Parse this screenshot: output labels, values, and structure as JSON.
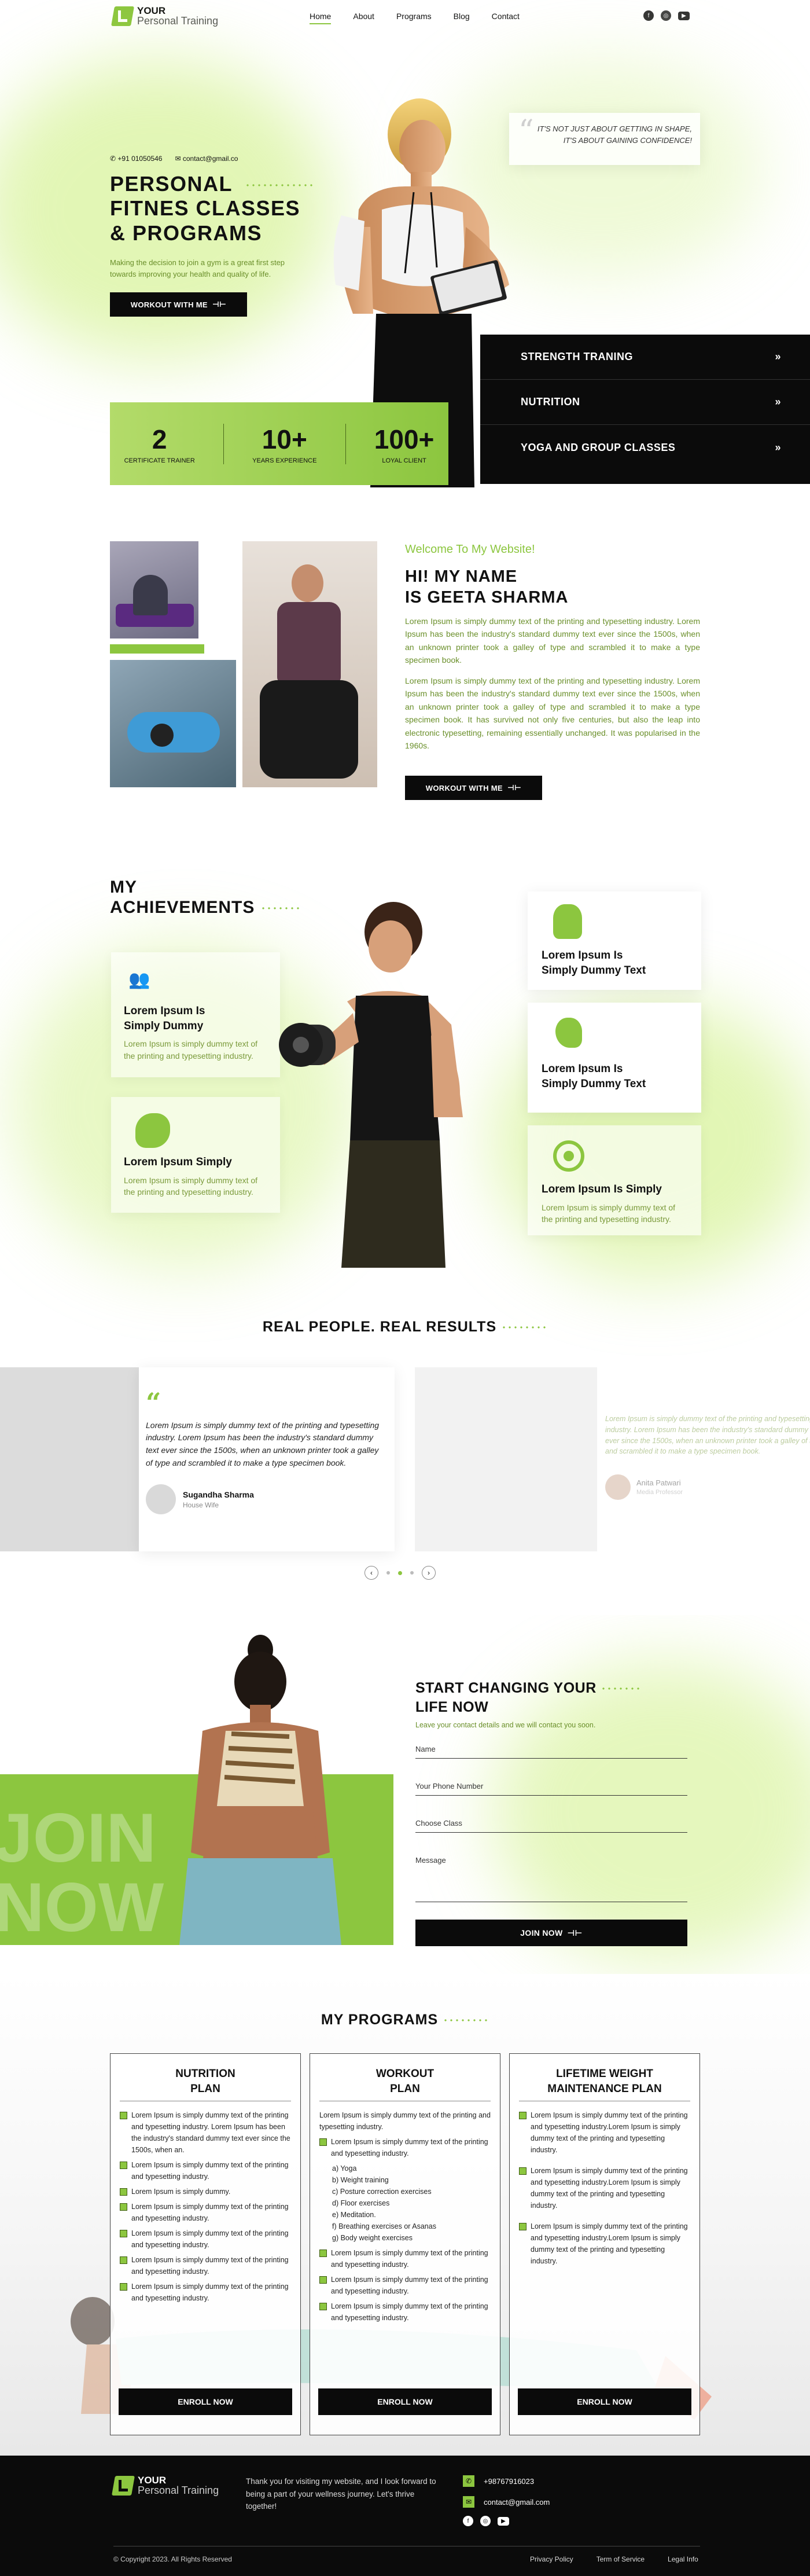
{
  "brand": {
    "line1": "YOUR",
    "line2": "Personal Training",
    "accent": "#8cc63f"
  },
  "nav": {
    "items": [
      "Home",
      "About",
      "Programs",
      "Blog",
      "Contact"
    ],
    "active": "Home"
  },
  "social": [
    "facebook-icon",
    "instagram-icon",
    "youtube-icon"
  ],
  "hero": {
    "phone": "+91 01050546",
    "email": "contact@gmail.co",
    "title_l1": "PERSONAL",
    "title_l2": "FITNES CLASSES",
    "title_l3": "& PROGRAMS",
    "subtitle": "Making the decision to join a gym is a great first step towards improving your health and quality of life.",
    "cta": "WORKOUT WITH ME",
    "quote": "IT'S NOT JUST ABOUT GETTING IN SHAPE, IT'S ABOUT GAINING CONFIDENCE!",
    "stats": [
      {
        "value": "2",
        "label": "CERTIFICATE TRAINER"
      },
      {
        "value": "10+",
        "label": "YEARS EXPERIENCE"
      },
      {
        "value": "100+",
        "label": "LOYAL CLIENT"
      }
    ],
    "services": [
      "STRENGTH TRANING",
      "NUTRITION",
      "YOGA AND GROUP CLASSES"
    ]
  },
  "about": {
    "welcome": "Welcome To My Website!",
    "title_l1": "HI! MY NAME",
    "title_l2": "IS GEETA SHARMA",
    "p1": "Lorem Ipsum is simply dummy text of the printing and typesetting industry. Lorem Ipsum has been the industry's standard dummy text ever since the 1500s, when an unknown printer took a galley of type and scrambled it to make a type specimen book.",
    "p2": "Lorem Ipsum is simply dummy text of the printing and typesetting industry. Lorem Ipsum has been the industry's standard dummy text ever since the 1500s, when an unknown printer took a galley of type and scrambled it to make a type specimen book. It has survived not only five centuries, but also the leap into electronic typesetting, remaining essentially unchanged. It was popularised in the 1960s.",
    "cta": "WORKOUT WITH ME"
  },
  "achievements": {
    "title_l1": "MY",
    "title_l2": "ACHIEVEMENTS",
    "left": [
      {
        "title": "Lorem Ipsum Is Simply Dummy",
        "text": "Lorem Ipsum is simply dummy text of the printing and typesetting industry.",
        "icon": "group-icon"
      },
      {
        "title": "Lorem Ipsum Simply",
        "text": "Lorem Ipsum is simply dummy text of the printing and typesetting industry.",
        "icon": "runner-icon"
      }
    ],
    "right": [
      {
        "title": "Lorem Ipsum Is Simply Dummy Text",
        "icon": "fitness-icon"
      },
      {
        "title": "Lorem Ipsum Is Simply Dummy Text",
        "icon": "head-icon"
      },
      {
        "title": "Lorem Ipsum Is Simply",
        "text": "Lorem Ipsum is simply dummy text of the printing and typesetting industry.",
        "icon": "target-icon"
      }
    ]
  },
  "testimonials": {
    "title": "REAL PEOPLE. REAL RESULTS",
    "active": {
      "text": "Lorem Ipsum is simply dummy text of the printing and typesetting industry. Lorem Ipsum has been the industry's standard dummy text ever since the 1500s, when an unknown printer took a galley of type and scrambled it to make a type specimen book.",
      "name": "Sugandha Sharma",
      "role": "House Wife"
    },
    "next": {
      "text": "Lorem Ipsum is simply dummy text of the printing and typesetting industry. Lorem Ipsum has been the industry's standard dummy text ever since the 1500s, when an unknown printer took a galley of type and scrambled it to make a type specimen book.",
      "name": "Anita Patwari",
      "role": "Media Professor"
    }
  },
  "contact": {
    "bg_text_l1": "JOIN",
    "bg_text_l2": "NOW",
    "title_l1": "START CHANGING YOUR",
    "title_l2": "LIFE NOW",
    "subtitle": "Leave your contact details and we will contact you soon.",
    "fields": [
      "Name",
      "Your Phone Number",
      "Choose Class",
      "Message"
    ],
    "submit": "JOIN NOW"
  },
  "programs": {
    "title": "MY PROGRAMS",
    "cards": [
      {
        "title_l1": "NUTRITION",
        "title_l2": "PLAN",
        "items": [
          "Lorem Ipsum is simply dummy text of the printing and typesetting industry. Lorem Ipsum has been the industry's standard dummy text ever since the 1500s, when an.",
          "Lorem Ipsum is simply dummy text of the printing and typesetting industry.",
          "Lorem Ipsum is simply dummy.",
          "Lorem Ipsum is simply dummy text of the printing and typesetting industry.",
          "Lorem Ipsum is simply dummy text of the printing and typesetting industry.",
          "Lorem Ipsum is simply dummy text of the printing and typesetting industry.",
          "Lorem Ipsum is simply dummy text of the printing and typesetting industry."
        ],
        "cta": "ENROLL NOW"
      },
      {
        "title_l1": "WORKOUT",
        "title_l2": "PLAN",
        "intro": "Lorem Ipsum is simply dummy text of the printing and typesetting industry.",
        "items": [
          "Lorem Ipsum is simply dummy text of the printing and typesetting industry.",
          "Lorem Ipsum is simply dummy text of the printing and typesetting industry.",
          "Lorem Ipsum is simply dummy text of the printing and typesetting industry.",
          "Lorem Ipsum is simply dummy text of the printing and typesetting industry."
        ],
        "sublist": [
          "a) Yoga",
          "b) Weight training",
          "c) Posture correction exercises",
          "d) Floor exercises",
          "e) Meditation.",
          "f) Breathing exercises or Asanas",
          "g) Body weight exercises"
        ],
        "cta": "ENROLL NOW"
      },
      {
        "title_l1": "LIFETIME WEIGHT",
        "title_l2": "MAINTENANCE PLAN",
        "items": [
          "Lorem Ipsum is simply dummy text of the printing and typesetting industry.Lorem Ipsum is simply dummy text of the printing and typesetting industry.",
          "Lorem Ipsum is simply dummy text of the printing and typesetting industry.Lorem Ipsum is simply dummy text of the printing and typesetting industry.",
          "Lorem Ipsum is simply dummy text of the printing and typesetting industry.Lorem Ipsum is simply dummy text of the printing and typesetting industry."
        ],
        "cta": "ENROLL NOW"
      }
    ]
  },
  "footer": {
    "tagline": "Thank you for visiting my website, and I look forward to being a part of your wellness journey. Let's thrive together!",
    "phone": "+98767916023",
    "email": "contact@gmail.com",
    "copyright": "© Copyright 2023. All Rights Reserved",
    "links": [
      "Privacy Policy",
      "Term of Service",
      "Legal Info"
    ]
  }
}
